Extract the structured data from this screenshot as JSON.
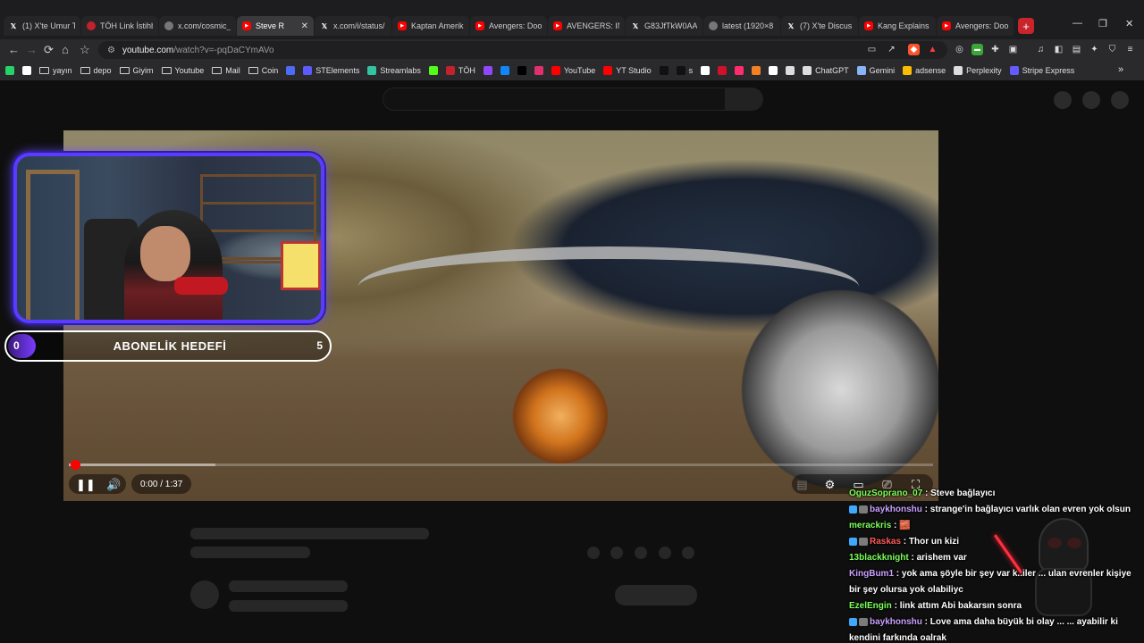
{
  "browser": {
    "tabs": [
      {
        "icon": "x",
        "label": "(1) X'te Umur T",
        "active": false
      },
      {
        "icon": "red",
        "label": "TÖH Link İstihb",
        "active": false
      },
      {
        "icon": "grey",
        "label": "x.com/cosmic_",
        "active": false
      },
      {
        "icon": "yt",
        "label": "Steve R",
        "active": true
      },
      {
        "icon": "x",
        "label": "x.com/i/status/",
        "active": false
      },
      {
        "icon": "yt",
        "label": "Kaptan Amerik",
        "active": false
      },
      {
        "icon": "yt",
        "label": "Avengers: Doo",
        "active": false
      },
      {
        "icon": "yt",
        "label": "AVENGERS: INF",
        "active": false
      },
      {
        "icon": "x",
        "label": "G83JfTkW0AA",
        "active": false
      },
      {
        "icon": "grey",
        "label": "latest (1920×8",
        "active": false
      },
      {
        "icon": "x",
        "label": "(7) X'te Discus",
        "active": false
      },
      {
        "icon": "yt",
        "label": "Kang Explains",
        "active": false
      },
      {
        "icon": "yt",
        "label": "Avengers: Doo",
        "active": false
      }
    ],
    "new_tab": "+",
    "window_controls": {
      "minimize": "—",
      "maximize": "❐",
      "close": "✕"
    },
    "nav": {
      "back": "←",
      "forward": "→",
      "reload": "⟳",
      "home": "⌂",
      "bookmark": "☆"
    },
    "address": {
      "host": "youtube.com",
      "path": "/watch?v=-pqDaCYmAVo"
    },
    "bookmarks": [
      {
        "icon": "whatsapp",
        "label": "",
        "color": "#25d366"
      },
      {
        "icon": "google",
        "label": "",
        "color": "#ffffff"
      },
      {
        "icon": "folder",
        "label": "yayın"
      },
      {
        "icon": "folder",
        "label": "depo"
      },
      {
        "icon": "folder",
        "label": "Giyim"
      },
      {
        "icon": "folder",
        "label": "Youtube"
      },
      {
        "icon": "folder",
        "label": "Mail"
      },
      {
        "icon": "folder",
        "label": "Coin"
      },
      {
        "icon": "r",
        "label": "",
        "color": "#4a6cf7"
      },
      {
        "icon": "steam",
        "label": "STElements",
        "color": "#5b5bff"
      },
      {
        "icon": "streamlabs",
        "label": "Streamlabs",
        "color": "#31c3a2"
      },
      {
        "icon": "kick",
        "label": "",
        "color": "#53fc18"
      },
      {
        "icon": "toh",
        "label": "TÖH",
        "color": "#c2222b"
      },
      {
        "icon": "twitch",
        "label": "",
        "color": "#9146ff"
      },
      {
        "icon": "bluesky",
        "label": "",
        "color": "#1185fe"
      },
      {
        "icon": "x",
        "label": "",
        "color": "#000000"
      },
      {
        "icon": "instagram",
        "label": "",
        "color": "#e1306c"
      },
      {
        "icon": "youtube",
        "label": "YouTube",
        "color": "#ff0000"
      },
      {
        "icon": "yt-studio",
        "label": "YT Studio",
        "color": "#ff0000"
      },
      {
        "icon": "tiktok",
        "label": "",
        "color": "#111111"
      },
      {
        "icon": "tiktok",
        "label": "s",
        "color": "#111111"
      },
      {
        "icon": "circle",
        "label": "",
        "color": "#ffffff"
      },
      {
        "icon": "red-icon",
        "label": "",
        "color": "#d0112b"
      },
      {
        "icon": "pink-icon",
        "label": "",
        "color": "#ff2d6f"
      },
      {
        "icon": "orange-icon",
        "label": "",
        "color": "#f48024"
      },
      {
        "icon": "notion",
        "label": "",
        "color": "#ffffff"
      },
      {
        "icon": "stack",
        "label": "",
        "color": "#dddddd"
      },
      {
        "icon": "chatgpt",
        "label": "ChatGPT",
        "color": "#dddddd"
      },
      {
        "icon": "gemini",
        "label": "Gemini",
        "color": "#8ab4f8"
      },
      {
        "icon": "adsense",
        "label": "adsense",
        "color": "#fbbc04"
      },
      {
        "icon": "perplexity",
        "label": "Perplexity",
        "color": "#dddddd"
      },
      {
        "icon": "stripe",
        "label": "Stripe Express",
        "color": "#635bff"
      }
    ],
    "bookmarks_overflow": "»"
  },
  "player": {
    "current_time": "0:00",
    "duration": "1:37",
    "time_display": "0:00 / 1:37",
    "progress_fraction": 0.0,
    "buffered_fraction": 0.17,
    "play_state": "playing"
  },
  "overlay": {
    "sub_goal": {
      "start": "0",
      "title": "ABONELİK HEDEFİ",
      "target": "5",
      "progress_fraction": 0.0
    }
  },
  "chat": [
    {
      "user": "OguzSoprano_07",
      "color": "#7cff5a",
      "badge": "none",
      "text": "Steve bağlayıcı"
    },
    {
      "user": "baykhonshu",
      "color": "#c9a0ff",
      "badge": "sub",
      "text": "strange'in bağlayıcı varlık olan evren yok olsun"
    },
    {
      "user": "merackris",
      "color": "#7cff5a",
      "badge": "none",
      "text": "🧱"
    },
    {
      "user": "Raskas",
      "color": "#ff5a5a",
      "badge": "sub",
      "text": "Thor un kizi"
    },
    {
      "user": "13blackknight",
      "color": "#7cff5a",
      "badge": "none",
      "text": "arishem var"
    },
    {
      "user": "KingBum1",
      "color": "#c9a0ff",
      "badge": "none",
      "text": "yok ama şöyle bir şey var k..iler ... ulan evrenler kişiye bir şey olursa yok olabiliyc"
    },
    {
      "user": "EzelEngin",
      "color": "#7cff5a",
      "badge": "none",
      "text": "link attım Abi bakarsın sonra"
    },
    {
      "user": "baykhonshu",
      "color": "#c9a0ff",
      "badge": "sub",
      "text": "Love ama daha büyük bi olay ... ... ayabilir ki kendini farkında oalrak"
    }
  ],
  "colors": {
    "accent_red": "#ff0000",
    "cam_border": "#5b3cff",
    "page_bg": "#0f0f0f"
  }
}
